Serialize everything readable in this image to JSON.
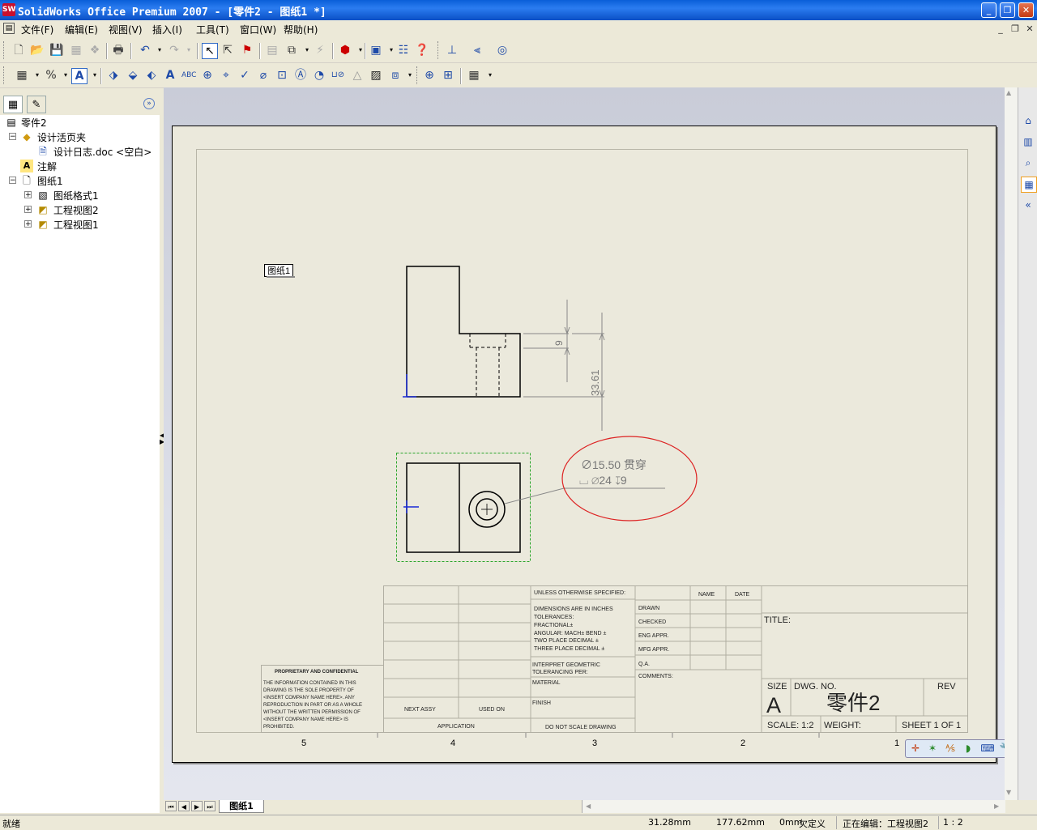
{
  "window": {
    "title": "SolidWorks Office Premium 2007 - [零件2 - 图纸1 *]",
    "app_icon_text": "SW"
  },
  "menu": [
    "文件(F)",
    "编辑(E)",
    "视图(V)",
    "插入(I)",
    "工具(T)",
    "窗口(W)",
    "帮助(H)"
  ],
  "feature_tree": {
    "root": "零件2",
    "items": [
      {
        "label": "设计活页夹",
        "icon": "folder-icon",
        "expanded": true
      },
      {
        "label": "设计日志.doc <空白>",
        "icon": "document-icon"
      },
      {
        "label": "注解",
        "icon": "annotation-icon"
      },
      {
        "label": "图纸1",
        "icon": "sheet-icon",
        "expanded": true
      },
      {
        "label": "图纸格式1",
        "icon": "sheet-format-icon"
      },
      {
        "label": "工程视图2",
        "icon": "drawing-view-icon"
      },
      {
        "label": "工程视图1",
        "icon": "drawing-view-icon"
      }
    ]
  },
  "drawing": {
    "sheet_label": "图纸1",
    "dim_small": "9",
    "dim_large": "33.61",
    "hole_callout_line1": "∅15.50 贯穿",
    "hole_callout_line2": "⌴ ∅24 ↧9",
    "zone_numbers": [
      "5",
      "4",
      "3",
      "2",
      "1"
    ],
    "title_block": {
      "unless": "UNLESS OTHERWISE SPECIFIED:",
      "dims_inches": "DIMENSIONS ARE IN INCHES",
      "tolerances": "TOLERANCES:",
      "fractional": "FRACTIONAL±",
      "angular": "ANGULAR: MACH±    BEND ±",
      "two_place": "TWO PLACE DECIMAL    ±",
      "three_place": "THREE PLACE DECIMAL  ±",
      "interpret": "INTERPRET GEOMETRIC",
      "tolerancing": "TOLERANCING PER:",
      "material": "MATERIAL",
      "finish": "FINISH",
      "do_not_scale": "DO NOT SCALE DRAWING",
      "next_assy": "NEXT ASSY",
      "used_on": "USED ON",
      "application": "APPLICATION",
      "name": "NAME",
      "date": "DATE",
      "drawn": "DRAWN",
      "checked": "CHECKED",
      "eng_appr": "ENG APPR.",
      "mfg_appr": "MFG APPR.",
      "qa": "Q.A.",
      "comments": "COMMENTS:",
      "title": "TITLE:",
      "size_label": "SIZE",
      "size": "A",
      "dwg_no_label": "DWG.  NO.",
      "dwg_no": "零件2",
      "rev": "REV",
      "scale": "SCALE: 1:2",
      "weight": "WEIGHT:",
      "sheet": "SHEET 1 OF 1",
      "proprietary_title": "PROPRIETARY AND CONFIDENTIAL",
      "proprietary_text": [
        "THE INFORMATION CONTAINED IN THIS",
        "DRAWING IS THE SOLE PROPERTY OF",
        "<INSERT COMPANY NAME HERE>. ANY",
        "REPRODUCTION IN PART OR AS A WHOLE",
        "WITHOUT THE WRITTEN PERMISSION OF",
        "<INSERT COMPANY NAME HERE> IS",
        "PROHIBITED."
      ]
    }
  },
  "sheet_tab": "图纸1",
  "status": {
    "ready": "就绪",
    "x": "31.28mm",
    "y": "177.62mm",
    "z": "0mm",
    "state": "欠定义",
    "editing": "正在编辑：工程视图2",
    "scale": "1 : 2"
  }
}
